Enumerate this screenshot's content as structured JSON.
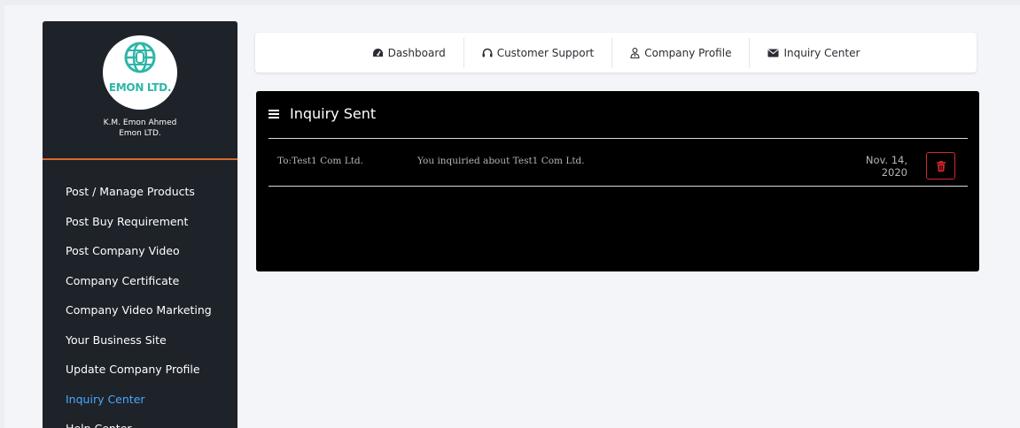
{
  "sidebar": {
    "logo_text": "EMON LTD.",
    "profile_name": "K.M. Emon Ahmed",
    "profile_company": "Emon LTD.",
    "items": [
      {
        "label": "Post / Manage Products"
      },
      {
        "label": "Post Buy Requirement"
      },
      {
        "label": "Post Company Video"
      },
      {
        "label": "Company Certificate"
      },
      {
        "label": "Company Video Marketing"
      },
      {
        "label": "Your Business Site"
      },
      {
        "label": "Update Company Profile"
      },
      {
        "label": "Inquiry Center",
        "active": true
      },
      {
        "label": "Help Center"
      }
    ]
  },
  "topnav": {
    "dashboard": "Dashboard",
    "support": "Customer Support",
    "profile": "Company Profile",
    "inquiry": "Inquiry Center"
  },
  "panel": {
    "title": "Inquiry Sent",
    "rows": [
      {
        "to": "To:Test1 Com Ltd.",
        "message": "You inquiried about Test1 Com Ltd.",
        "date": "Nov. 14, 2020"
      }
    ]
  },
  "colors": {
    "sidebar_bg": "#1e2229",
    "accent_orange": "#d96a2b",
    "active_link": "#4aa8ff",
    "delete_red": "#d9262d",
    "logo_teal": "#2db6a8"
  },
  "icons": {
    "dashboard": "tachometer-icon",
    "support": "headphones-icon",
    "profile": "user-tie-icon",
    "inquiry": "envelope-icon",
    "menu": "hamburger-icon",
    "delete": "trash-icon"
  }
}
